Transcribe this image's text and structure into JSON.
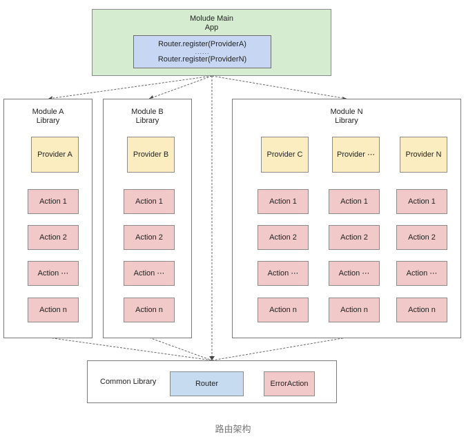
{
  "main_app": {
    "title_line1": "Molude Main",
    "title_line2": "App",
    "register_first": "Router.register(ProviderA)",
    "register_ellipsis": "......",
    "register_last": "Router.register(ProviderN)"
  },
  "modules": [
    {
      "title_line1": "Module A",
      "title_line2": "Library",
      "providers": [
        {
          "label": "Provider A",
          "actions": [
            "Action 1",
            "Action 2",
            "Action ⋯",
            "Action n"
          ]
        }
      ]
    },
    {
      "title_line1": "Module B",
      "title_line2": "Library",
      "providers": [
        {
          "label": "Provider B",
          "actions": [
            "Action 1",
            "Action 2",
            "Action ⋯",
            "Action n"
          ]
        }
      ]
    },
    {
      "title_line1": "Module N",
      "title_line2": "Library",
      "providers": [
        {
          "label": "Provider C",
          "actions": [
            "Action 1",
            "Action 2",
            "Action ⋯",
            "Action n"
          ]
        },
        {
          "label": "Provider ⋯",
          "actions": [
            "Action 1",
            "Action 2",
            "Action ⋯",
            "Action n"
          ]
        },
        {
          "label": "Provider N",
          "actions": [
            "Action 1",
            "Action 2",
            "Action ⋯",
            "Action n"
          ]
        }
      ]
    }
  ],
  "common_library": {
    "label": "Common Library",
    "router": "Router",
    "error_action": "ErrorAction"
  },
  "caption": "路由架构",
  "colors": {
    "main_app_fill": "#d5ecd0",
    "register_fill": "#c7d7f3",
    "provider_fill": "#fbedc0",
    "action_fill": "#f1c9c9",
    "router_fill": "#c6daf0"
  }
}
